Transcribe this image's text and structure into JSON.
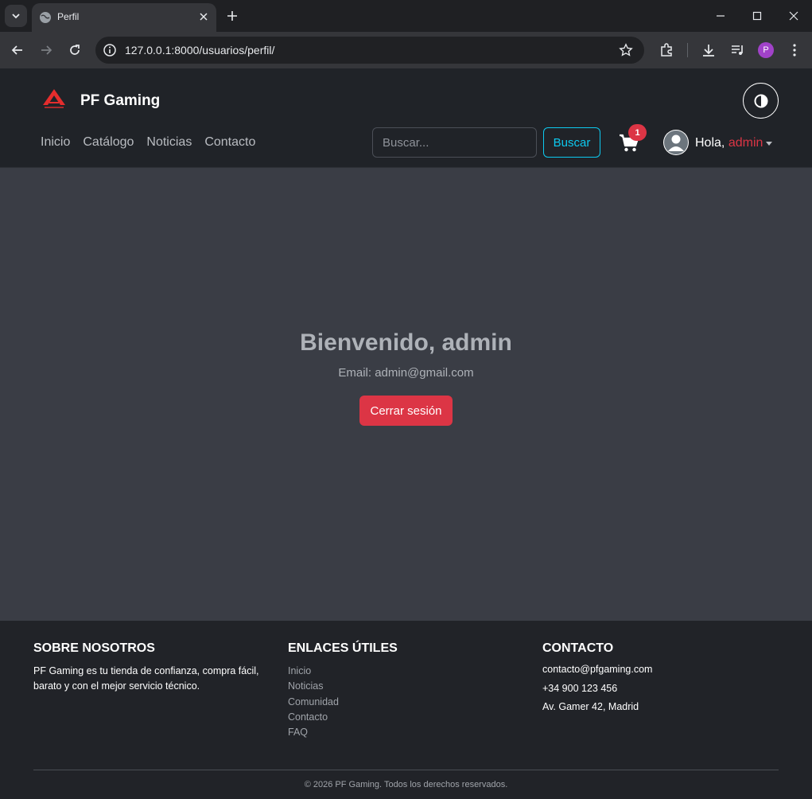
{
  "browser": {
    "tab_title": "Perfil",
    "url": "127.0.0.1:8000/usuarios/perfil/",
    "profile_initial": "P"
  },
  "header": {
    "brand": "PF Gaming",
    "nav": [
      "Inicio",
      "Catálogo",
      "Noticias",
      "Contacto"
    ],
    "search_placeholder": "Buscar...",
    "search_button": "Buscar",
    "cart_count": "1",
    "greeting": "Hola,",
    "username": "admin"
  },
  "main": {
    "welcome": "Bienvenido, admin",
    "email": "Email: admin@gmail.com",
    "logout": "Cerrar sesión"
  },
  "footer": {
    "about_title": "SOBRE NOSOTROS",
    "about_text": "PF Gaming es tu tienda de confianza, compra fácil, barato y con el mejor servicio técnico.",
    "links_title": "ENLACES ÚTILES",
    "links": [
      "Inicio",
      "Noticias",
      "Comunidad",
      "Contacto",
      "FAQ"
    ],
    "contact_title": "CONTACTO",
    "contact": [
      "contacto@pfgaming.com",
      "+34 900 123 456",
      "Av. Gamer 42, Madrid"
    ],
    "copyright": "© 2026 PF Gaming. Todos los derechos reservados."
  },
  "colors": {
    "accent_red": "#dc3545",
    "accent_cyan": "#0dcaf0",
    "header_bg": "#202328",
    "main_bg": "#3a3d45"
  }
}
